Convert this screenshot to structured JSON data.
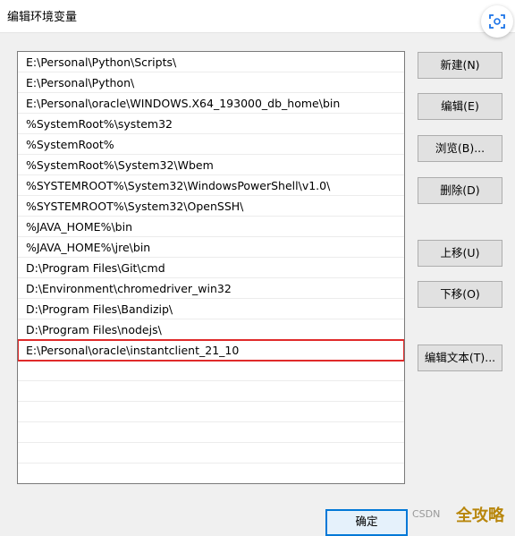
{
  "window": {
    "title": "编辑环境变量"
  },
  "path_list": {
    "entries": [
      "E:\\Personal\\Python\\Scripts\\",
      "E:\\Personal\\Python\\",
      "E:\\Personal\\oracle\\WINDOWS.X64_193000_db_home\\bin",
      "%SystemRoot%\\system32",
      "%SystemRoot%",
      "%SystemRoot%\\System32\\Wbem",
      "%SYSTEMROOT%\\System32\\WindowsPowerShell\\v1.0\\",
      "%SYSTEMROOT%\\System32\\OpenSSH\\",
      "%JAVA_HOME%\\bin",
      "%JAVA_HOME%\\jre\\bin",
      "D:\\Program Files\\Git\\cmd",
      "D:\\Environment\\chromedriver_win32",
      "D:\\Program Files\\Bandizip\\",
      "D:\\Program Files\\nodejs\\",
      "E:\\Personal\\oracle\\instantclient_21_10"
    ],
    "selected_index": 14
  },
  "buttons": {
    "new": "新建(N)",
    "edit": "编辑(E)",
    "browse": "浏览(B)...",
    "delete": "删除(D)",
    "move_up": "上移(U)",
    "move_down": "下移(O)",
    "edit_text": "编辑文本(T)...",
    "ok": "确定"
  },
  "watermark": {
    "text": "CSDN",
    "logo": "全攻略"
  },
  "colors": {
    "selection_outline": "#e02a2a",
    "ok_border": "#0078d7"
  }
}
